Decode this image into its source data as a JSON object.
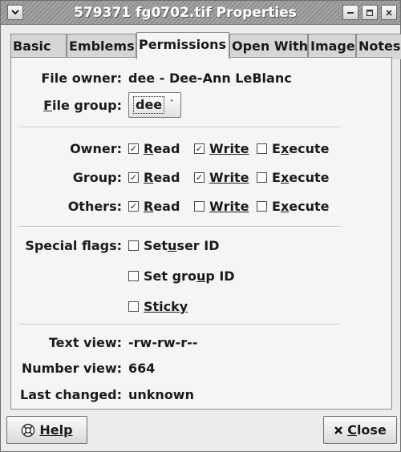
{
  "window": {
    "title": "579371 fg0702.tif Properties"
  },
  "tabs": [
    {
      "label": "Basic",
      "active": false
    },
    {
      "label": "Emblems",
      "active": false
    },
    {
      "label": "Permissions",
      "active": true
    },
    {
      "label": "Open With",
      "active": false
    },
    {
      "label": "Image",
      "active": false
    },
    {
      "label": "Notes",
      "active": false
    }
  ],
  "owner": {
    "label": "File owner:",
    "value": "dee - Dee-Ann LeBlanc"
  },
  "group": {
    "label_mnemonic": "F",
    "label_rest": "ile group:",
    "value": "dee"
  },
  "permissions": {
    "read_mnemonic": "R",
    "read_rest": "ead",
    "write_mnemonic": "W",
    "write_rest": "rite",
    "execute_pre": "E",
    "execute_mnemonic": "x",
    "execute_rest": "ecute",
    "rows": [
      {
        "label": "Owner:",
        "read": true,
        "write": true,
        "execute": false
      },
      {
        "label": "Group:",
        "read": true,
        "write": true,
        "execute": false
      },
      {
        "label": "Others:",
        "read": true,
        "write": false,
        "execute": false
      }
    ]
  },
  "special_flags": {
    "label": "Special flags:",
    "set_user_id": {
      "pre": "Set ",
      "mnemonic": "u",
      "rest": "ser ID",
      "checked": false
    },
    "set_group_id": {
      "pre": "Set gro",
      "mnemonic": "u",
      "rest": "p ID",
      "checked": false
    },
    "sticky": {
      "mnemonic": "S",
      "rest": "ticky",
      "checked": false
    }
  },
  "views": {
    "text_label": "Text view:",
    "text_value": "-rw-rw-r--",
    "number_label": "Number view:",
    "number_value": "664",
    "changed_label": "Last changed:",
    "changed_value": "unknown"
  },
  "buttons": {
    "help_mnemonic": "H",
    "help_rest": "elp",
    "close_mnemonic": "C",
    "close_rest": "lose"
  },
  "icons": {
    "menu": "chevron-down-icon",
    "minimize": "minimize-icon",
    "maximize": "maximize-icon",
    "close": "close-icon",
    "help": "help-icon",
    "close_button": "x-icon",
    "check": "checkmark-icon"
  }
}
